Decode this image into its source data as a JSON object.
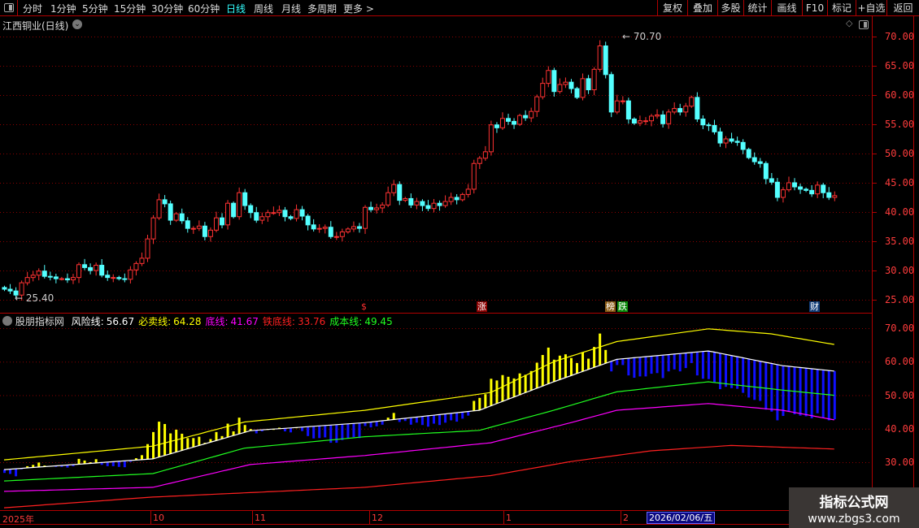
{
  "toolbar": {
    "periods": [
      "分时",
      "1分钟",
      "5分钟",
      "15分钟",
      "30分钟",
      "60分钟",
      "日线",
      "周线",
      "月线",
      "多周期",
      "更多 >"
    ],
    "active": "日线",
    "right_buttons": [
      "复权",
      "叠加",
      "多股",
      "统计",
      "画线",
      "F10",
      "标记",
      "+自选",
      "返回"
    ]
  },
  "main": {
    "title": "江西铜业(日线)",
    "high_label": "70.70",
    "low_label": "25.40",
    "y_ticks": [
      "70.00",
      "65.00",
      "60.00",
      "55.00",
      "50.00",
      "45.00",
      "40.00",
      "35.00",
      "30.00",
      "25.00"
    ],
    "events": [
      {
        "label": "$",
        "bg": "transparent",
        "color": "#ff3030"
      },
      {
        "label": "涨",
        "bg": "#8b0000",
        "color": "#fff"
      },
      {
        "label": "榜",
        "bg": "#8b5a14",
        "color": "#fff"
      },
      {
        "label": "跌",
        "bg": "#0a8a0a",
        "color": "#fff"
      },
      {
        "label": "财",
        "bg": "#123c78",
        "color": "#fff"
      }
    ]
  },
  "indicator": {
    "name": "股朋指标网",
    "lines": [
      {
        "label": "风险线:",
        "value": "56.67",
        "color": "#ffffff"
      },
      {
        "label": "必卖线:",
        "value": "64.28",
        "color": "#ffff00"
      },
      {
        "label": "底线:",
        "value": "41.67",
        "color": "#ff00ff"
      },
      {
        "label": "铁底线:",
        "value": "33.76",
        "color": "#ff2020"
      },
      {
        "label": "成本线:",
        "value": "49.45",
        "color": "#20ff20"
      }
    ],
    "y_ticks": [
      "70.00",
      "60.00",
      "50.00",
      "40.00",
      "30.00"
    ]
  },
  "date_axis": {
    "labels": [
      "2025年",
      "10",
      "11",
      "12",
      "1",
      "2"
    ],
    "cursor_date": "2026/02/06/五"
  },
  "watermark": {
    "title": "指标公式网",
    "url": "www.zbgs3.com"
  },
  "colors": {
    "up": "#ff3232",
    "down": "#54ffff",
    "grid": "#8b0000",
    "border": "#b00000"
  },
  "chart_data": {
    "type": "candlestick",
    "price_range": [
      25,
      70
    ],
    "closes": [
      26.8,
      26.5,
      25.8,
      27.9,
      28.8,
      29.2,
      29.9,
      29.0,
      28.9,
      28.6,
      28.6,
      28.4,
      28.8,
      31.0,
      30.5,
      30.0,
      30.9,
      29.2,
      28.8,
      28.8,
      28.6,
      28.5,
      30.1,
      31.2,
      32.1,
      35.4,
      39.0,
      42.1,
      41.4,
      38.6,
      39.7,
      38.5,
      37.2,
      37.2,
      37.6,
      35.8,
      36.9,
      39.0,
      37.8,
      41.5,
      39.2,
      43.3,
      41.1,
      39.9,
      38.6,
      39.2,
      39.9,
      39.9,
      40.3,
      39.2,
      38.9,
      40.4,
      39.3,
      37.8,
      37.1,
      37.2,
      37.4,
      35.8,
      35.8,
      36.6,
      37.1,
      37.5,
      37.2,
      40.8,
      40.4,
      40.7,
      41.2,
      43.3,
      44.7,
      42.0,
      42.3,
      41.2,
      41.8,
      41.1,
      40.6,
      41.5,
      41.1,
      41.8,
      42.5,
      42.1,
      43.0,
      43.9,
      48.3,
      49.2,
      50.3,
      54.9,
      54.4,
      56.0,
      55.5,
      55.0,
      56.5,
      56.1,
      57.2,
      59.7,
      62.0,
      64.2,
      60.6,
      61.8,
      62.2,
      61.1,
      59.6,
      62.8,
      60.9,
      64.4,
      68.4,
      63.5,
      57.1,
      59.0,
      59.0,
      55.9,
      55.2,
      55.6,
      55.6,
      56.4,
      56.6,
      55.1,
      57.1,
      57.7,
      57.1,
      58.1,
      59.6,
      55.9,
      54.9,
      54.8,
      53.7,
      51.8,
      52.5,
      52.1,
      51.9,
      50.7,
      49.3,
      48.6,
      48.3,
      45.7,
      45.1,
      42.5,
      43.8,
      45.0,
      44.3,
      43.9,
      43.7,
      43.1,
      44.6,
      43.3,
      42.5,
      42.8
    ],
    "indicator_range": [
      25,
      72
    ],
    "indicator_series": [
      {
        "name": "必卖线",
        "color": "#ffff00",
        "points": [
          [
            0,
            30.7
          ],
          [
            26,
            34.8
          ],
          [
            42,
            42
          ],
          [
            63,
            45.5
          ],
          [
            85,
            50.8
          ],
          [
            96,
            60
          ],
          [
            107,
            66
          ],
          [
            123,
            69.8
          ],
          [
            134,
            68.3
          ],
          [
            148,
            64.28
          ]
        ]
      },
      {
        "name": "风险线",
        "color": "#ffffff",
        "points": [
          [
            0,
            27.8
          ],
          [
            26,
            31
          ],
          [
            43,
            39.4
          ],
          [
            63,
            41.8
          ],
          [
            83,
            45.5
          ],
          [
            96,
            54
          ],
          [
            107,
            60.7
          ],
          [
            123,
            63.2
          ],
          [
            136,
            58.8
          ],
          [
            148,
            56.67
          ]
        ]
      },
      {
        "name": "成本线",
        "color": "#20ff20",
        "points": [
          [
            0,
            24.4
          ],
          [
            26,
            26.6
          ],
          [
            42,
            34.2
          ],
          [
            63,
            37.6
          ],
          [
            83,
            39.5
          ],
          [
            96,
            45.5
          ],
          [
            107,
            51
          ],
          [
            123,
            54
          ],
          [
            136,
            51.5
          ],
          [
            148,
            49.45
          ]
        ]
      },
      {
        "name": "底线",
        "color": "#ff00ff",
        "points": [
          [
            0,
            21.3
          ],
          [
            26,
            22.5
          ],
          [
            43,
            29.3
          ],
          [
            63,
            32
          ],
          [
            85,
            35.8
          ],
          [
            99,
            41.8
          ],
          [
            107,
            45.5
          ],
          [
            123,
            47.5
          ],
          [
            136,
            45.5
          ],
          [
            148,
            41.67
          ]
        ]
      },
      {
        "name": "铁底线",
        "color": "#ff2020",
        "points": [
          [
            0,
            16.4
          ],
          [
            26,
            19.6
          ],
          [
            63,
            22.5
          ],
          [
            85,
            26
          ],
          [
            99,
            30.2
          ],
          [
            113,
            33.4
          ],
          [
            127,
            35
          ],
          [
            148,
            33.76
          ]
        ]
      }
    ]
  }
}
